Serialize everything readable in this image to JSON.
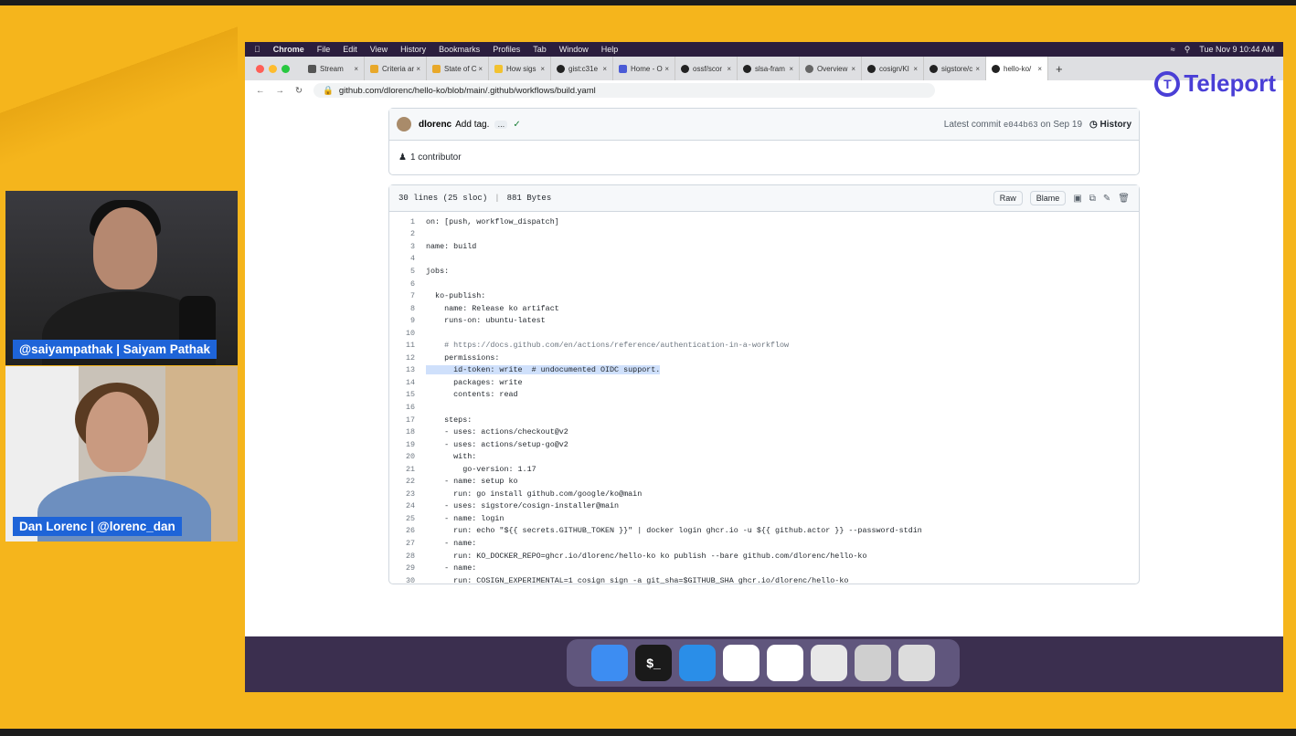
{
  "colors": {
    "background": "#f5b51c",
    "teleport": "#4a3fd6",
    "nameplate": "#1e64d8"
  },
  "menubar": {
    "app": "Chrome",
    "items": [
      "File",
      "Edit",
      "View",
      "History",
      "Bookmarks",
      "Profiles",
      "Tab",
      "Window",
      "Help"
    ],
    "clock": "Tue Nov 9 10:44 AM"
  },
  "tabs": [
    {
      "label": "Stream",
      "color": "#555"
    },
    {
      "label": "Criteria ar",
      "color": "#e8a82a"
    },
    {
      "label": "State of C",
      "color": "#e8a82a"
    },
    {
      "label": "How sigs",
      "color": "#f2c230"
    },
    {
      "label": "gist:c31e",
      "color": "#222"
    },
    {
      "label": "Home - O",
      "color": "#4b5bd6"
    },
    {
      "label": "ossf/scor",
      "color": "#222"
    },
    {
      "label": "slsa-fram",
      "color": "#222"
    },
    {
      "label": "Overview",
      "color": "#666"
    },
    {
      "label": "cosign/KI",
      "color": "#222"
    },
    {
      "label": "sigstore/c",
      "color": "#222"
    },
    {
      "label": "hello-ko/",
      "color": "#222"
    }
  ],
  "url": "github.com/dlorenc/hello-ko/blob/main/.github/workflows/build.yaml",
  "teleport": "Teleport",
  "commit": {
    "author": "dlorenc",
    "message": "Add tag.",
    "latest_label": "Latest commit",
    "sha": "e044b63",
    "date": "on Sep 19",
    "history": "History",
    "contributors": "1 contributor"
  },
  "file": {
    "lines_info": "30 lines (25 sloc)",
    "size": "881 Bytes",
    "raw": "Raw",
    "blame": "Blame"
  },
  "code": [
    "on: [push, workflow_dispatch]",
    "",
    "name: build",
    "",
    "jobs:",
    "",
    "  ko-publish:",
    "    name: Release ko artifact",
    "    runs-on: ubuntu-latest",
    "",
    "    # https://docs.github.com/en/actions/reference/authentication-in-a-workflow",
    "    permissions:",
    "      id-token: write  # undocumented OIDC support.",
    "      packages: write",
    "      contents: read",
    "",
    "    steps:",
    "    - uses: actions/checkout@v2",
    "    - uses: actions/setup-go@v2",
    "      with:",
    "        go-version: 1.17",
    "    - name: setup ko",
    "      run: go install github.com/google/ko@main",
    "    - uses: sigstore/cosign-installer@main",
    "    - name: login",
    "      run: echo \"${{ secrets.GITHUB_TOKEN }}\" | docker login ghcr.io -u ${{ github.actor }} --password-stdin",
    "    - name:",
    "      run: KO_DOCKER_REPO=ghcr.io/dlorenc/hello-ko ko publish --bare github.com/dlorenc/hello-ko",
    "    - name:",
    "      run: COSIGN_EXPERIMENTAL=1 cosign sign -a git_sha=$GITHUB_SHA ghcr.io/dlorenc/hello-ko"
  ],
  "dock": [
    {
      "name": "finder",
      "color": "#3d8df2",
      "glyph": ""
    },
    {
      "name": "terminal",
      "color": "#1a1a1a",
      "glyph": "$_"
    },
    {
      "name": "vscode",
      "color": "#2a8ee8",
      "glyph": ""
    },
    {
      "name": "slack",
      "color": "#ffffff",
      "glyph": ""
    },
    {
      "name": "chrome",
      "color": "#ffffff",
      "glyph": ""
    },
    {
      "name": "documents",
      "color": "#e8e8e8",
      "glyph": ""
    },
    {
      "name": "window-preview",
      "color": "#cfcfcf",
      "glyph": ""
    },
    {
      "name": "trash",
      "color": "#dcdcdc",
      "glyph": ""
    }
  ],
  "participants": [
    {
      "label": "@saiyampathak | Saiyam Pathak"
    },
    {
      "label": "Dan Lorenc | @lorenc_dan"
    }
  ]
}
